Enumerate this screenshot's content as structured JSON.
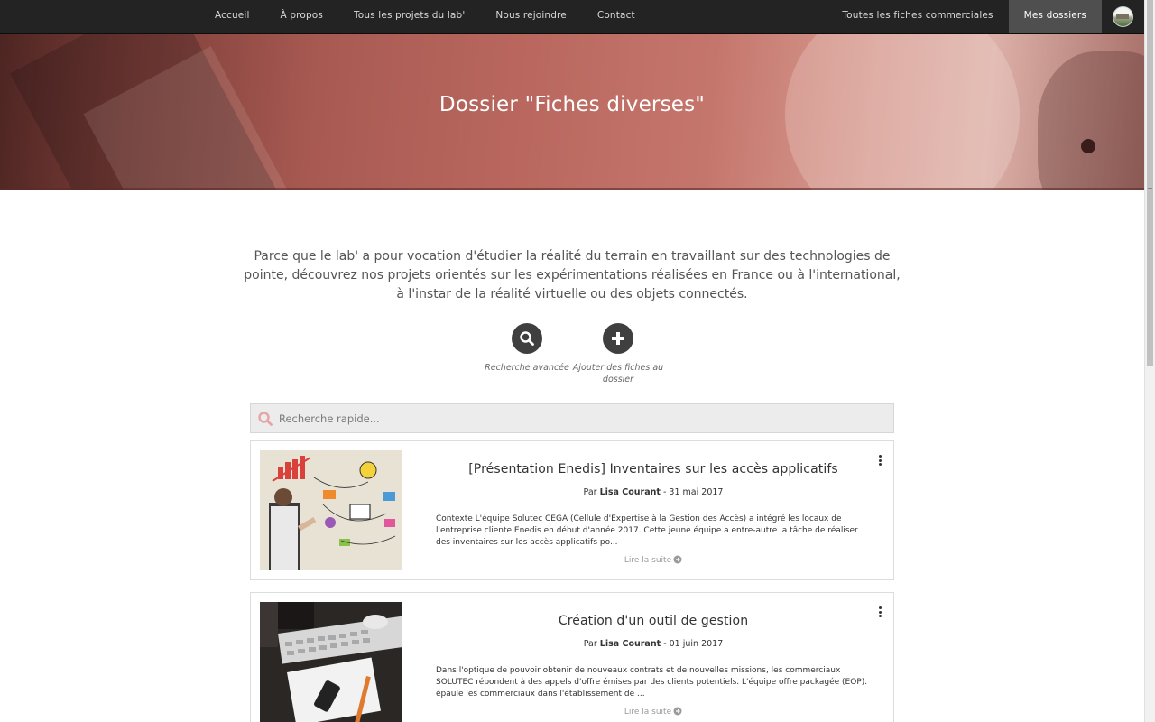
{
  "nav": {
    "left": [
      "Accueil",
      "À propos",
      "Tous les projets du lab'",
      "Nous rejoindre",
      "Contact"
    ],
    "right": [
      "Toutes les fiches commerciales",
      "Mes dossiers"
    ],
    "active": "Mes dossiers"
  },
  "hero": {
    "title": "Dossier \"Fiches diverses\""
  },
  "intro": "Parce que le lab' a pour vocation d'étudier la réalité du terrain en travaillant sur des technologies de pointe, découvrez nos projets orientés sur les expérimentations réalisées en France ou à l'international, à l'instar de la réalité virtuelle ou des objets connectés.",
  "actions": {
    "search_label": "Recherche avancée",
    "add_label": "Ajouter des fiches au dossier"
  },
  "quick_search": {
    "placeholder": "Recherche rapide..."
  },
  "cards": [
    {
      "title": "[Présentation Enedis] Inventaires sur les accès applicatifs",
      "by": "Par",
      "author": "Lisa Courant",
      "date": "- 31 mai 2017",
      "excerpt": "Contexte L'équipe Solutec CEGA (Cellule d'Expertise à la Gestion des Accès) a intégré les locaux de l'entreprise cliente Enedis en début d'année 2017. Cette jeune équipe a entre-autre la tâche de réaliser des inventaires sur les accès applicatifs po...",
      "more": "Lire la suite"
    },
    {
      "title": "Création d'un outil de gestion",
      "by": "Par",
      "author": "Lisa Courant",
      "date": "- 01 juin 2017",
      "excerpt": "Dans l'optique de pouvoir obtenir de nouveaux contrats et de nouvelles missions, les commerciaux SOLUTEC répondent à des appels d'offre émises par des clients potentiels. L'équipe offre packagée (EOP). épaule les commerciaux dans l'établissement de ...",
      "more": "Lire la suite"
    }
  ],
  "colors": {
    "nav_bg": "#232323",
    "nav_active_bg": "#4f4f4f",
    "hero_tint": "#b9675e",
    "search_icon": "#e7a5a5",
    "action_circle": "#3f3f3f"
  },
  "icons": {
    "search": "search-icon",
    "add": "plus-icon",
    "menu": "vertical-dots-icon",
    "more": "arrow-circle-right-icon"
  }
}
